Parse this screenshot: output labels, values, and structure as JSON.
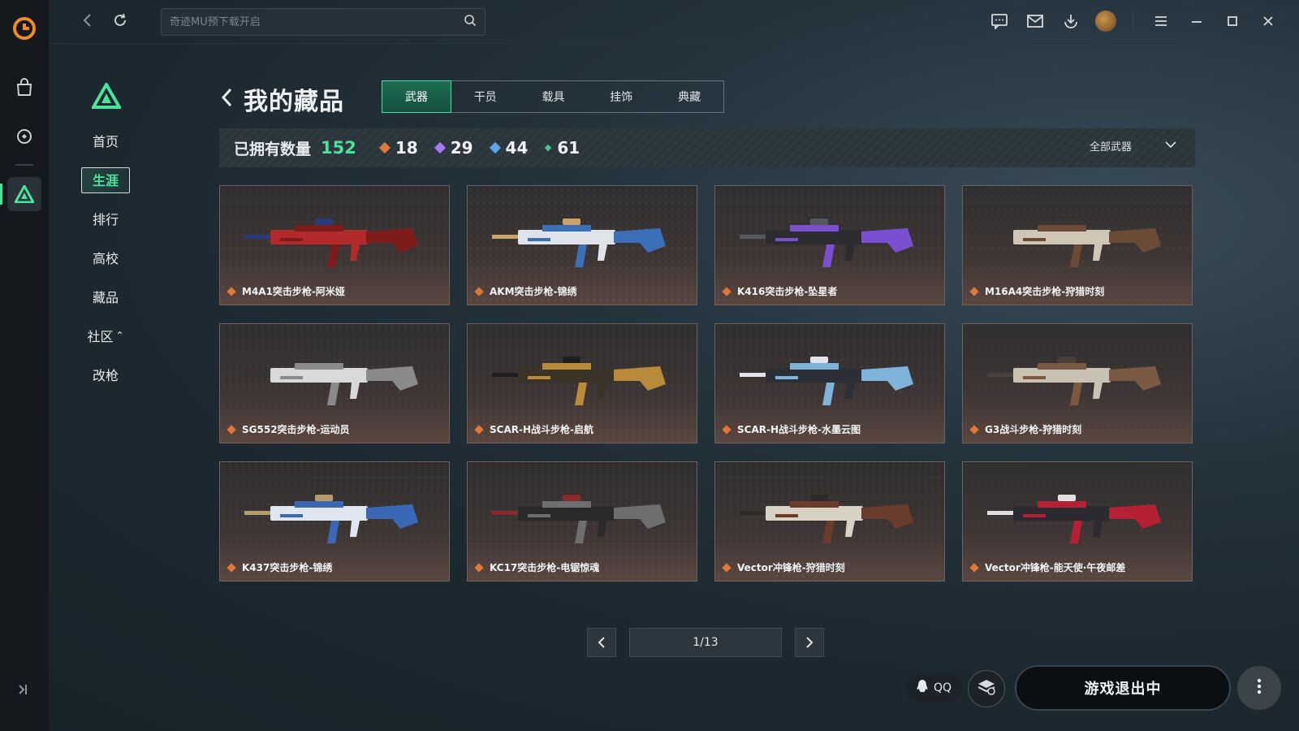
{
  "colors": {
    "accent": "#4be39a",
    "rarity_orange": "#e0783a",
    "rarity_purple": "#a67cf0",
    "rarity_blue": "#5aa6e8",
    "rarity_green": "#46c98f"
  },
  "search": {
    "placeholder": "奇迹MU预下载开启"
  },
  "sidebar": {
    "items": [
      {
        "label": "首页"
      },
      {
        "label": "生涯"
      },
      {
        "label": "排行"
      },
      {
        "label": "高校"
      },
      {
        "label": "藏品"
      },
      {
        "label": "社区"
      },
      {
        "label": "改枪"
      }
    ],
    "active": "生涯",
    "community_caret": "⌃"
  },
  "page": {
    "title": "我的藏品"
  },
  "tabs": [
    "武器",
    "干员",
    "载具",
    "挂饰",
    "典藏"
  ],
  "active_tab": "武器",
  "stats": {
    "owned_label": "已拥有数量",
    "owned_count": "152",
    "orange": "18",
    "purple": "29",
    "blue": "44",
    "green": "61"
  },
  "filter": {
    "label": "全部武器"
  },
  "items": [
    {
      "name": "M4A1突击步枪-阿米娅"
    },
    {
      "name": "AKM突击步枪-锦绣"
    },
    {
      "name": "K416突击步枪-坠星者"
    },
    {
      "name": "M16A4突击步枪-狩猎时刻"
    },
    {
      "name": "SG552突击步枪-运动员"
    },
    {
      "name": "SCAR-H战斗步枪-启航"
    },
    {
      "name": "SCAR-H战斗步枪-水墨云图"
    },
    {
      "name": "G3战斗步枪-狩猎时刻"
    },
    {
      "name": "K437突击步枪-锦绣"
    },
    {
      "name": "KC17突击步枪-电锯惊魂"
    },
    {
      "name": "Vector冲锋枪-狩猎时刻"
    },
    {
      "name": "Vector冲锋枪-能天使·午夜邮差"
    }
  ],
  "pagination": {
    "page": "1/13"
  },
  "footer": {
    "qq_label": "QQ",
    "play_label": "游戏退出中"
  }
}
